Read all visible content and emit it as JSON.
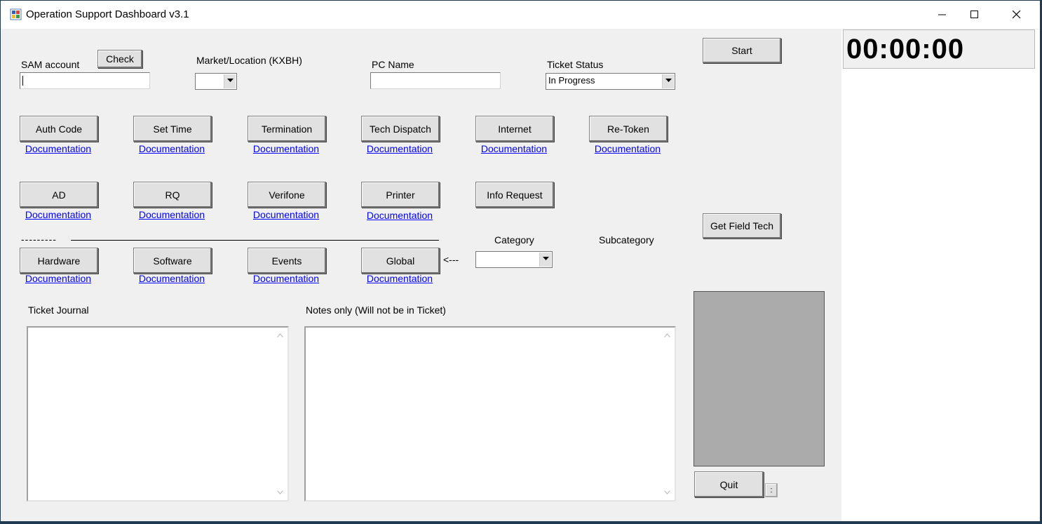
{
  "window": {
    "title": "Operation Support Dashboard v3.1"
  },
  "top": {
    "sam_label": "SAM account",
    "check_label": "Check",
    "sam_value": "",
    "market_label": "Market/Location (KXBH)",
    "market_value": "",
    "pc_label": "PC Name",
    "pc_value": "",
    "status_label": "Ticket Status",
    "status_value": "In Progress"
  },
  "side": {
    "start_label": "Start",
    "timer": "00:00:00",
    "field_tech_label": "Get Field Tech",
    "quit_label": "Quit",
    "small_btn_label": ":"
  },
  "row1": [
    {
      "label": "Auth Code",
      "doc": "Documentation"
    },
    {
      "label": "Set Time",
      "doc": "Documentation"
    },
    {
      "label": "Termination",
      "doc": "Documentation"
    },
    {
      "label": "Tech Dispatch",
      "doc": "Documentation"
    },
    {
      "label": "Internet",
      "doc": "Documentation"
    },
    {
      "label": "Re-Token",
      "doc": "Documentation"
    }
  ],
  "row2": [
    {
      "label": "AD",
      "doc": "Documentation"
    },
    {
      "label": "RQ",
      "doc": "Documentation"
    },
    {
      "label": "Verifone",
      "doc": "Documentation"
    },
    {
      "label": "Printer",
      "doc": "Documentation"
    },
    {
      "label": "Info Request"
    }
  ],
  "divider_dashes": "---------",
  "row3": [
    {
      "label": "Hardware",
      "doc": "Documentation"
    },
    {
      "label": "Software",
      "doc": "Documentation"
    },
    {
      "label": "Events",
      "doc": "Documentation"
    },
    {
      "label": "Global",
      "doc": "Documentation"
    }
  ],
  "arrow_text": "<---",
  "category": {
    "label": "Category",
    "value": "",
    "subcategory_label": "Subcategory"
  },
  "journal": {
    "label": "Ticket Journal",
    "value": ""
  },
  "notes": {
    "label": "Notes only (Will not be in Ticket)",
    "value": ""
  },
  "colors": {
    "form_bg": "#f0f0f0",
    "link": "#0000ff",
    "image_panel": "#ababab",
    "frame": "#1f3a52"
  }
}
